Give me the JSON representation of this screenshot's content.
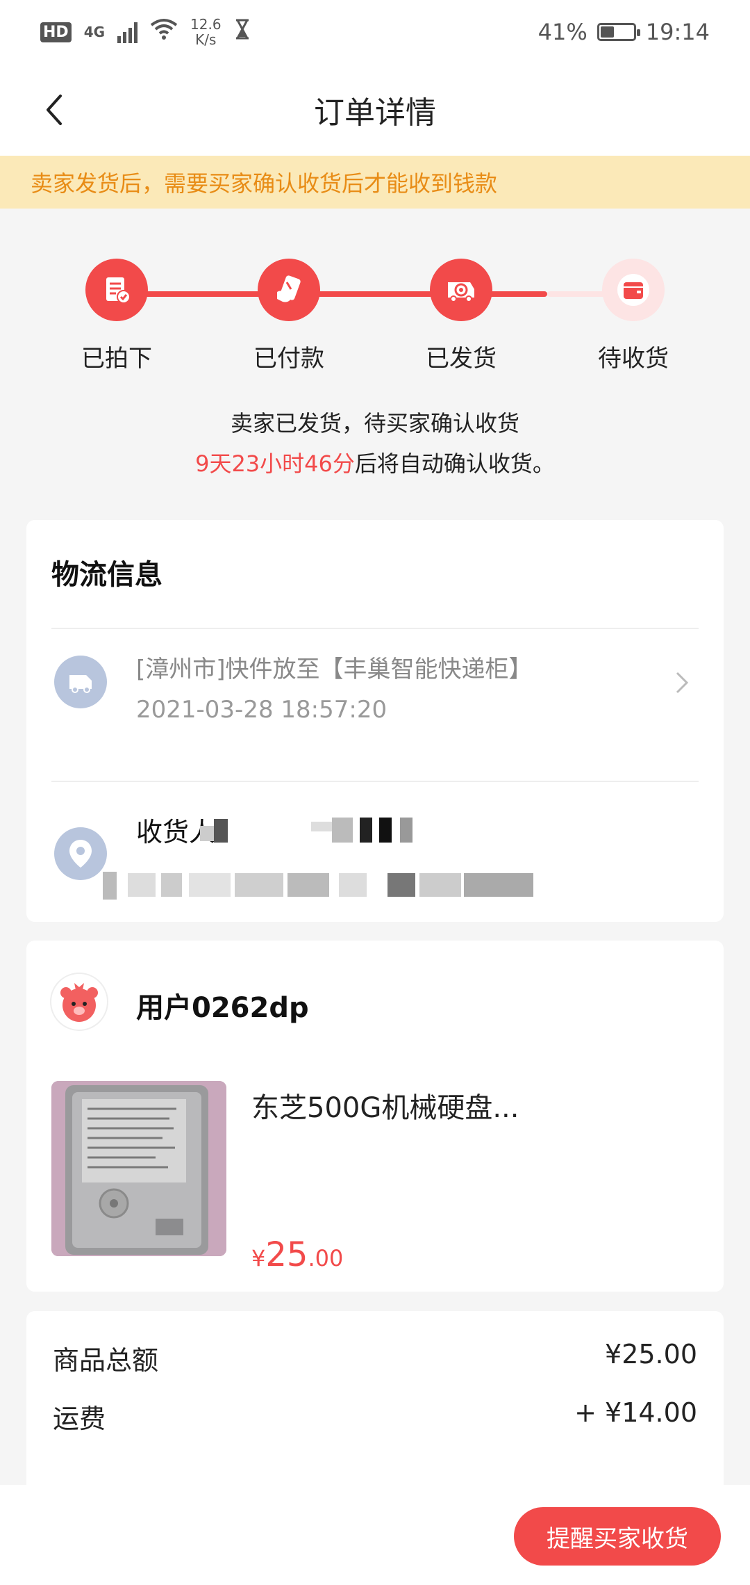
{
  "status_bar": {
    "hd": "HD",
    "network": "4G",
    "speed_value": "12.6",
    "speed_unit": "K/s",
    "battery": "41%",
    "battery_level": 0.41,
    "time": "19:14"
  },
  "nav": {
    "title": "订单详情"
  },
  "notice": {
    "text": "卖家发货后，需要买家确认收货后才能收到钱款"
  },
  "progress": {
    "steps": [
      {
        "label": "已拍下",
        "done": true
      },
      {
        "label": "已付款",
        "done": true
      },
      {
        "label": "已发货",
        "done": true
      },
      {
        "label": "待收货",
        "done": false
      }
    ],
    "status_line1": "卖家已发货，待买家确认收货",
    "countdown": "9天23小时46分",
    "status_line2_suffix": "后将自动确认收货。"
  },
  "logistics": {
    "title": "物流信息",
    "latest": "[漳州市]快件放至【丰巢智能快递柜】",
    "latest_time": "2021-03-28 18:57:20",
    "receiver_label": "收货人："
  },
  "seller": {
    "name": "用户0262dp",
    "product_title": "东芝500G机械硬盘...",
    "price_symbol": "¥",
    "price_int": "25",
    "price_dec": ".00"
  },
  "summary": {
    "rows": [
      {
        "label": "商品总额",
        "value": "¥25.00"
      },
      {
        "label": "运费",
        "value": "+ ¥14.00"
      }
    ]
  },
  "actions": {
    "remind_label": "提醒买家收货"
  },
  "colors": {
    "accent": "#f24a4a",
    "notice_bg": "#fbe9b8",
    "notice_text": "#e88c16",
    "muted_icon": "#b8c5dd"
  }
}
